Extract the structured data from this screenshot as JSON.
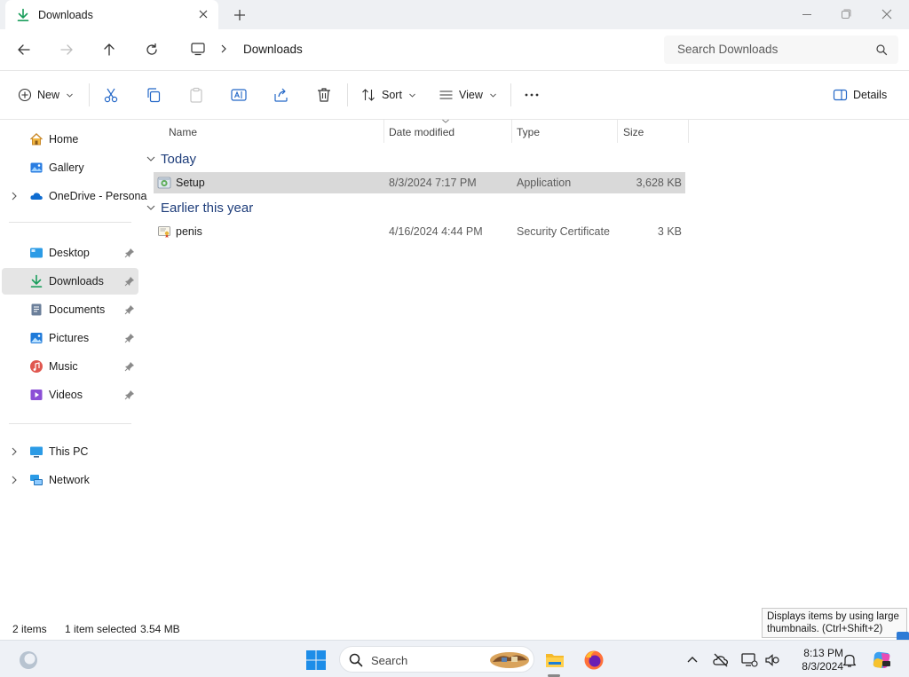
{
  "window": {
    "tab_title": "Downloads",
    "tab_icon": "downloads-icon",
    "controls": [
      "minimize-icon",
      "maximize-icon",
      "close-icon"
    ]
  },
  "address": {
    "breadcrumb": "Downloads",
    "search_placeholder": "Search Downloads"
  },
  "commands": {
    "new_label": "New",
    "sort_label": "Sort",
    "view_label": "View",
    "details_label": "Details"
  },
  "sidebar": {
    "home": "Home",
    "gallery": "Gallery",
    "onedrive": "OneDrive - Persona",
    "quick_access": [
      {
        "label": "Desktop",
        "icon": "desktop-icon"
      },
      {
        "label": "Downloads",
        "icon": "downloads-icon",
        "selected": true
      },
      {
        "label": "Documents",
        "icon": "documents-icon"
      },
      {
        "label": "Pictures",
        "icon": "pictures-icon"
      },
      {
        "label": "Music",
        "icon": "music-icon"
      },
      {
        "label": "Videos",
        "icon": "videos-icon"
      }
    ],
    "this_pc": "This PC",
    "network": "Network"
  },
  "columns": {
    "name": "Name",
    "date_modified": "Date modified",
    "type": "Type",
    "size": "Size"
  },
  "groups": [
    {
      "title": "Today",
      "files": [
        {
          "name": "Setup",
          "date": "8/3/2024 7:17 PM",
          "type": "Application",
          "size": "3,628 KB",
          "selected": true,
          "icon": "setup-app-icon"
        }
      ]
    },
    {
      "title": "Earlier this year",
      "files": [
        {
          "name": "penis",
          "date": "4/16/2024 4:44 PM",
          "type": "Security Certificate",
          "size": "3 KB",
          "selected": false,
          "icon": "certificate-icon"
        }
      ]
    }
  ],
  "status": {
    "item_count": "2 items",
    "selection": "1 item selected",
    "selection_size": "3.54 MB"
  },
  "tooltip": {
    "line1": "Displays items by using large",
    "line2": "thumbnails.  (Ctrl+Shift+2)"
  },
  "taskbar": {
    "search_placeholder": "Search",
    "time": "8:13 PM",
    "date": "8/3/2024"
  },
  "colors": {
    "accent": "#0067c0",
    "selection": "#d9d9d9",
    "group_title": "#1e3d7a"
  }
}
